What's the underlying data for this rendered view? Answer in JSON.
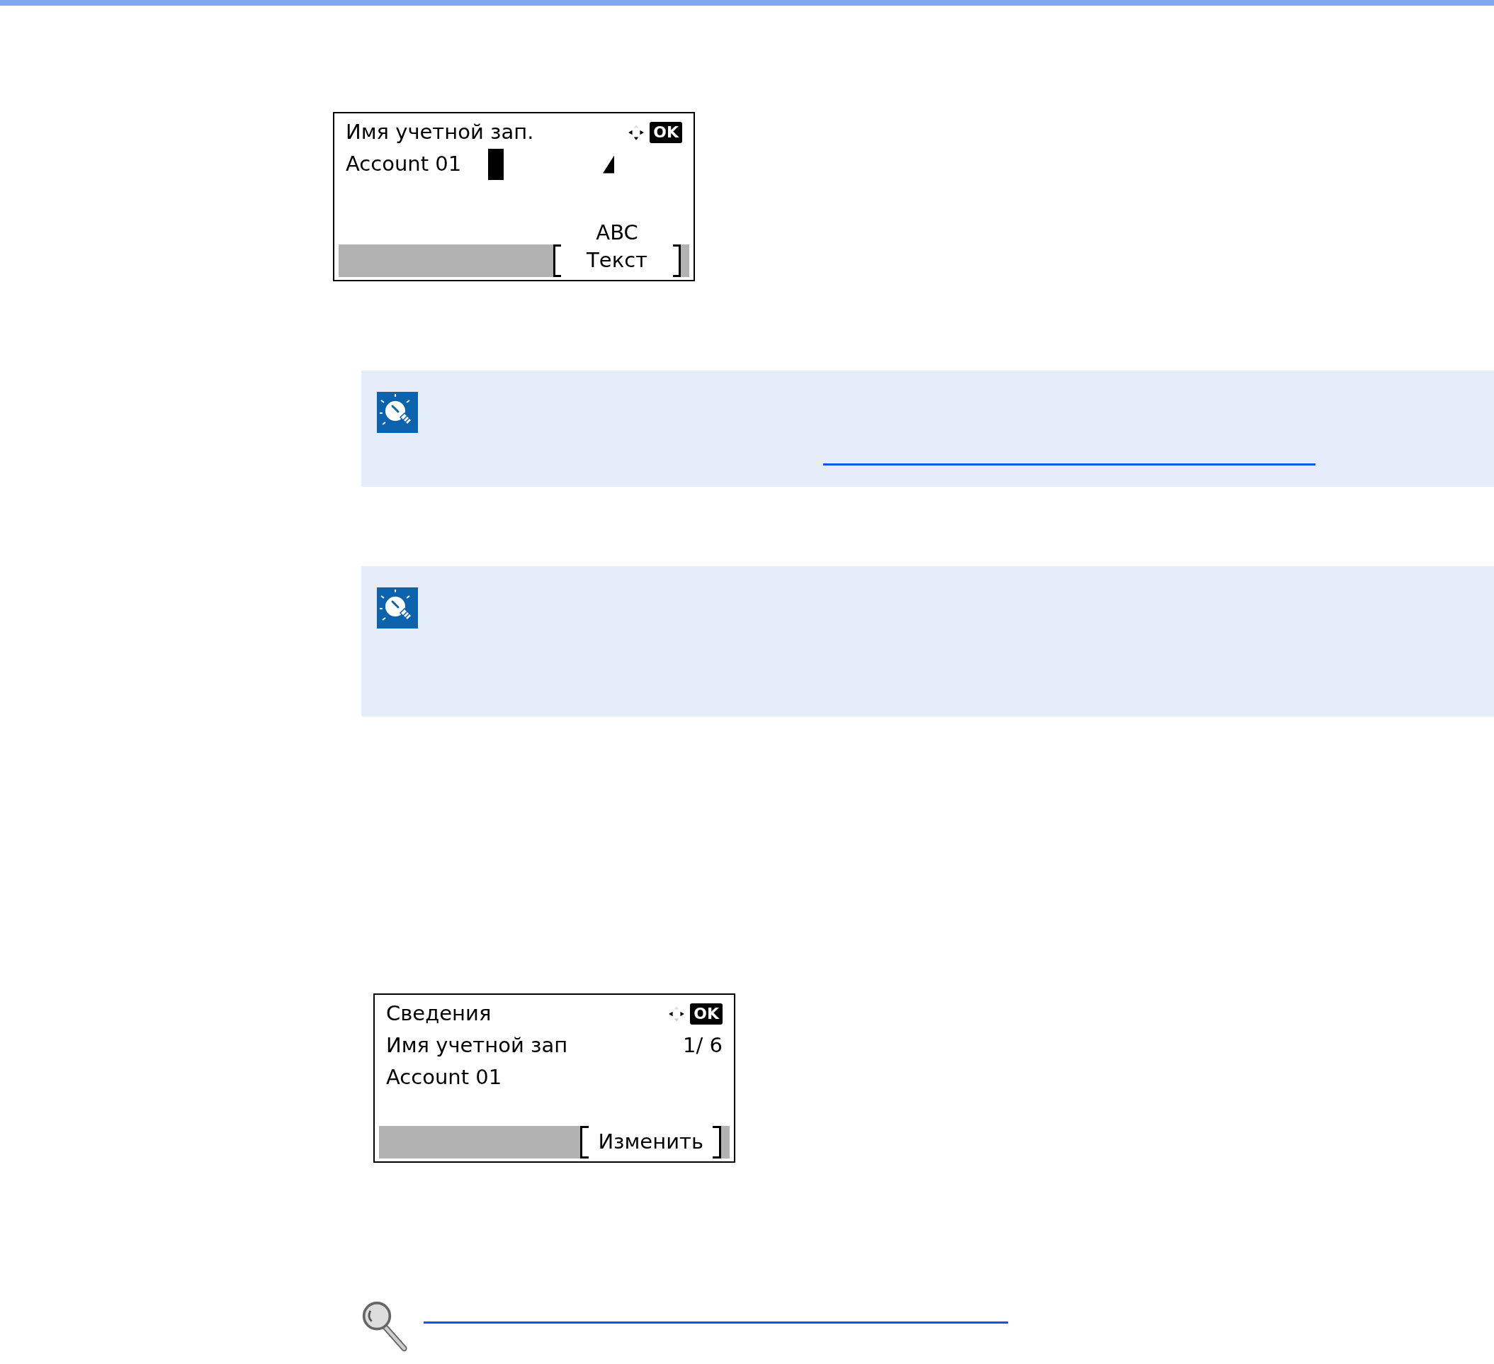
{
  "screens": [
    {
      "title": "Имя учетной зап.",
      "ok": "OK",
      "lines": [
        {
          "kind": "input",
          "text": "Account 01"
        }
      ],
      "softkey": {
        "mode": "ABC",
        "label": "Текст"
      }
    },
    {
      "title": "Сведения",
      "ok": "OK",
      "lines": [
        {
          "kind": "text",
          "text": "Имя учетной зап",
          "aside": "1/ 6"
        },
        {
          "kind": "text",
          "text": "Account 01"
        }
      ],
      "softkey": {
        "label": "Изменить"
      }
    }
  ]
}
